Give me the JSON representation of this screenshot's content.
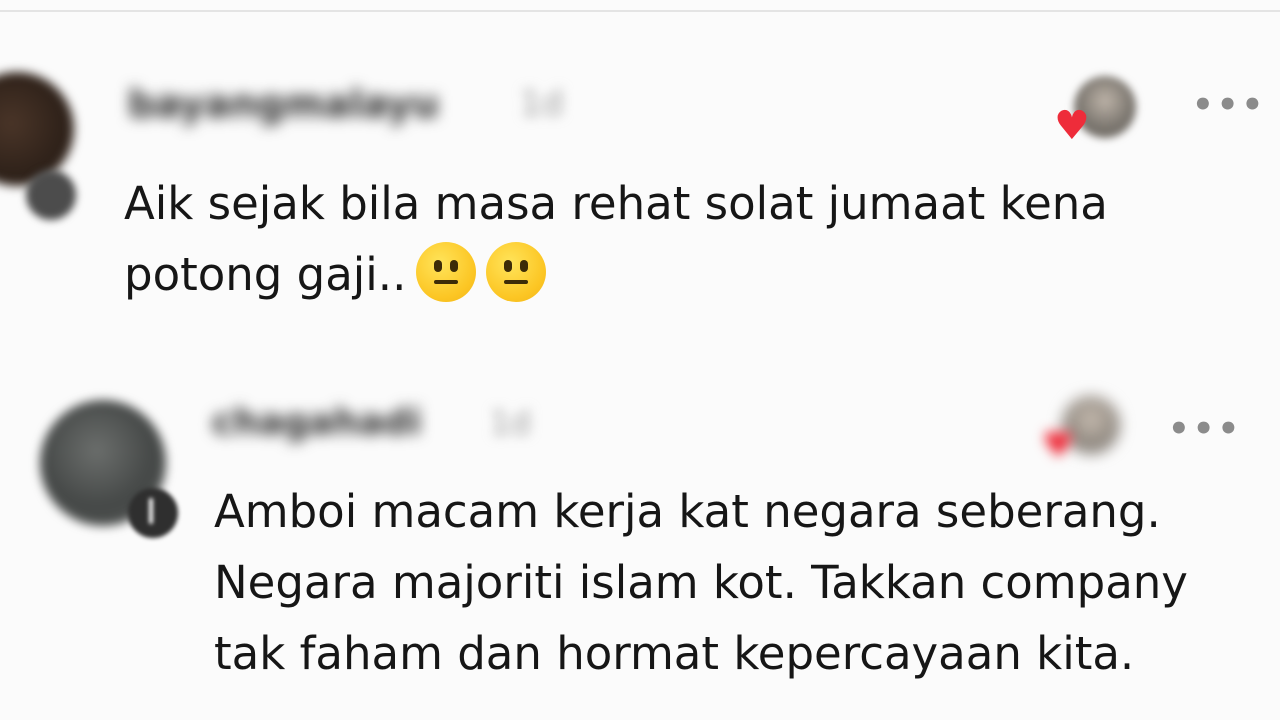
{
  "comments": [
    {
      "username": "bayangmalayu",
      "time": "1d",
      "more_label": "•••",
      "text_lines": [
        "Aik sejak bila masa rehat solat jumaat kena",
        "potong gaji.."
      ],
      "emojis": [
        "neutral-face-emoji",
        "neutral-face-emoji"
      ],
      "reaction_icon": "heart-icon",
      "reaction_color": "#ee2c3a"
    },
    {
      "username": "chagahadi",
      "time": "1d",
      "more_label": "•••",
      "text_lines": [
        "Amboi macam kerja kat negara seberang.",
        "Negara majoriti islam kot. Takkan company",
        "tak faham dan hormat kepercayaan kita."
      ],
      "reaction_icon": "heart-icon",
      "reaction_color": "#ee2c3a"
    }
  ]
}
